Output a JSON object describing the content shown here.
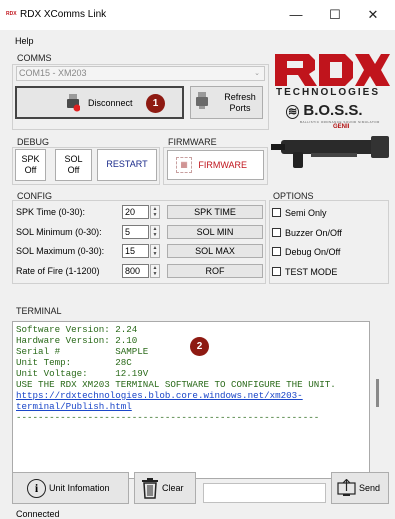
{
  "window": {
    "title": "RDX XComms Link",
    "icon_text": "RDX",
    "controls": {
      "minimize": "—",
      "maximize": "☐",
      "close": "✕"
    }
  },
  "menu": {
    "help": "Help"
  },
  "comms": {
    "label": "COMMS",
    "port_value": "COM15 - XM203",
    "disconnect_label": "Disconnect",
    "refresh_label_1": "Refresh",
    "refresh_label_2": "Ports",
    "badge": "1"
  },
  "debug": {
    "label": "DEBUG",
    "spk_1": "SPK",
    "spk_2": "Off",
    "sol_1": "SOL",
    "sol_2": "Off",
    "restart": "RESTART"
  },
  "firmware": {
    "label": "FIRMWARE",
    "button": "FIRMWARE"
  },
  "logo": {
    "tech": "TECHNOLOGIES",
    "boss": "B.O.S.S.",
    "sub": "BALLISTIC ORDNANCE SOUND SIMULATOR",
    "gen": "GENII"
  },
  "config": {
    "label": "CONFIG",
    "rows": [
      {
        "label": "SPK Time (0-30):",
        "value": "20",
        "button": "SPK TIME"
      },
      {
        "label": "SOL Minimum (0-30):",
        "value": "5",
        "button": "SOL MIN"
      },
      {
        "label": "SOL Maximum (0-30):",
        "value": "15",
        "button": "SOL MAX"
      },
      {
        "label": "Rate of Fire (1-1200)",
        "value": "800",
        "button": "ROF"
      }
    ]
  },
  "options": {
    "label": "OPTIONS",
    "items": [
      {
        "label": "Semi Only",
        "checked": false
      },
      {
        "label": "Buzzer On/Off",
        "checked": false
      },
      {
        "label": "Debug On/Off",
        "checked": false
      },
      {
        "label": "TEST MODE",
        "checked": false
      }
    ]
  },
  "terminal": {
    "label": "TERMINAL",
    "badge": "2",
    "lines": [
      "Software Version: 2.24",
      "Hardware Version: 2.10",
      "Serial #          SAMPLE",
      "Unit Temp:        28C",
      "Unit Voltage:     12.19V",
      "USE THE RDX XM203 TERMINAL SOFTWARE TO CONFIGURE THE UNIT."
    ],
    "link_1": "https://rdxtechnologies.blob.core.windows.net/xm203-",
    "link_2": "terminal/Publish.html",
    "separator": "-------------------------------------------------------"
  },
  "bottom": {
    "info_label": "Unit Infomation",
    "clear_label": "Clear",
    "send_label": "Send",
    "send_value": ""
  },
  "status": {
    "text": "Connected"
  },
  "colors": {
    "brand_red": "#c0141c",
    "badge": "#8e1a12",
    "terminal_text": "#2a6a1a",
    "link": "#1a46c8"
  }
}
